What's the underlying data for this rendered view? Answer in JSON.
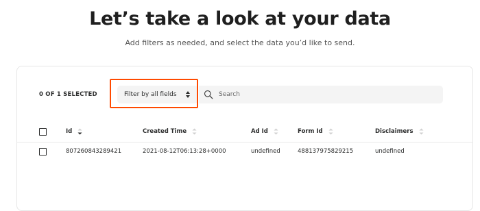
{
  "header": {
    "title": "Let’s take a look at your data",
    "subtitle": "Add filters as needed, and select the data you’d like to send."
  },
  "toolbar": {
    "selection_count": "0 OF 1 SELECTED",
    "filter_value": "Filter by all fields",
    "search_placeholder": "Search"
  },
  "table": {
    "columns": [
      {
        "label": "Id",
        "sorted": "desc"
      },
      {
        "label": "Created Time",
        "sorted": "none"
      },
      {
        "label": "Ad Id",
        "sorted": "none"
      },
      {
        "label": "Form Id",
        "sorted": "none"
      },
      {
        "label": "Disclaimers",
        "sorted": "none"
      }
    ],
    "rows": [
      {
        "selected": false,
        "cells": [
          "807260843289421",
          "2021-08-12T06:13:28+0000",
          "undefined",
          "488137975829215",
          "undefined"
        ]
      }
    ]
  },
  "colors": {
    "highlight": "#ff4a00",
    "control_bg": "#f4f4f4",
    "text": "#2d2e2e"
  }
}
